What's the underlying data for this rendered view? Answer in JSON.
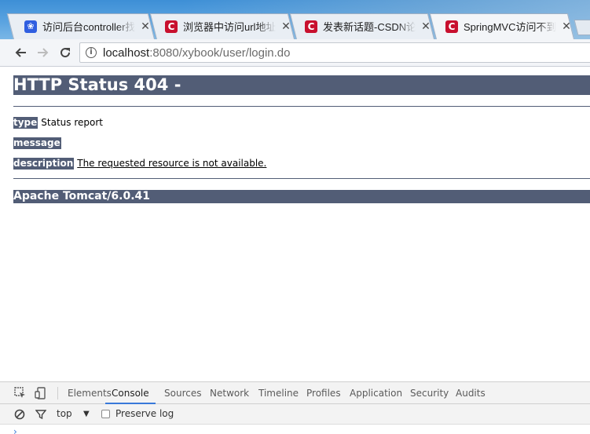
{
  "browser": {
    "tabs": [
      {
        "title": "访问后台controller找",
        "favicon": "paw-icon",
        "active": false
      },
      {
        "title": "浏览器中访问url地址访",
        "favicon": "csdn-c-icon",
        "active": false
      },
      {
        "title": "发表新话题-CSDN论坛",
        "favicon": "csdn-c-icon",
        "active": false
      },
      {
        "title": "SpringMVC访问不到",
        "favicon": "csdn-c-icon",
        "active": true
      }
    ],
    "tab_close_glyph": "✕",
    "url_host": "localhost",
    "url_rest": ":8080/xybook/user/login.do"
  },
  "page": {
    "heading": "HTTP Status 404 -",
    "type_label": "type",
    "type_value": "Status report",
    "message_label": "message",
    "message_value": "",
    "description_label": "description",
    "description_value": "The requested resource is not available.",
    "footer": "Apache Tomcat/6.0.41"
  },
  "devtools": {
    "tabs": [
      "Elements",
      "Console",
      "Sources",
      "Network",
      "Timeline",
      "Profiles",
      "Application",
      "Security",
      "Audits"
    ],
    "active_tab": "Console",
    "context": "top",
    "preserve_log_label": "Preserve log",
    "prompt_glyph": "›"
  },
  "colors": {
    "tomcat_bar": "#525d76",
    "accent": "#3879d9"
  }
}
